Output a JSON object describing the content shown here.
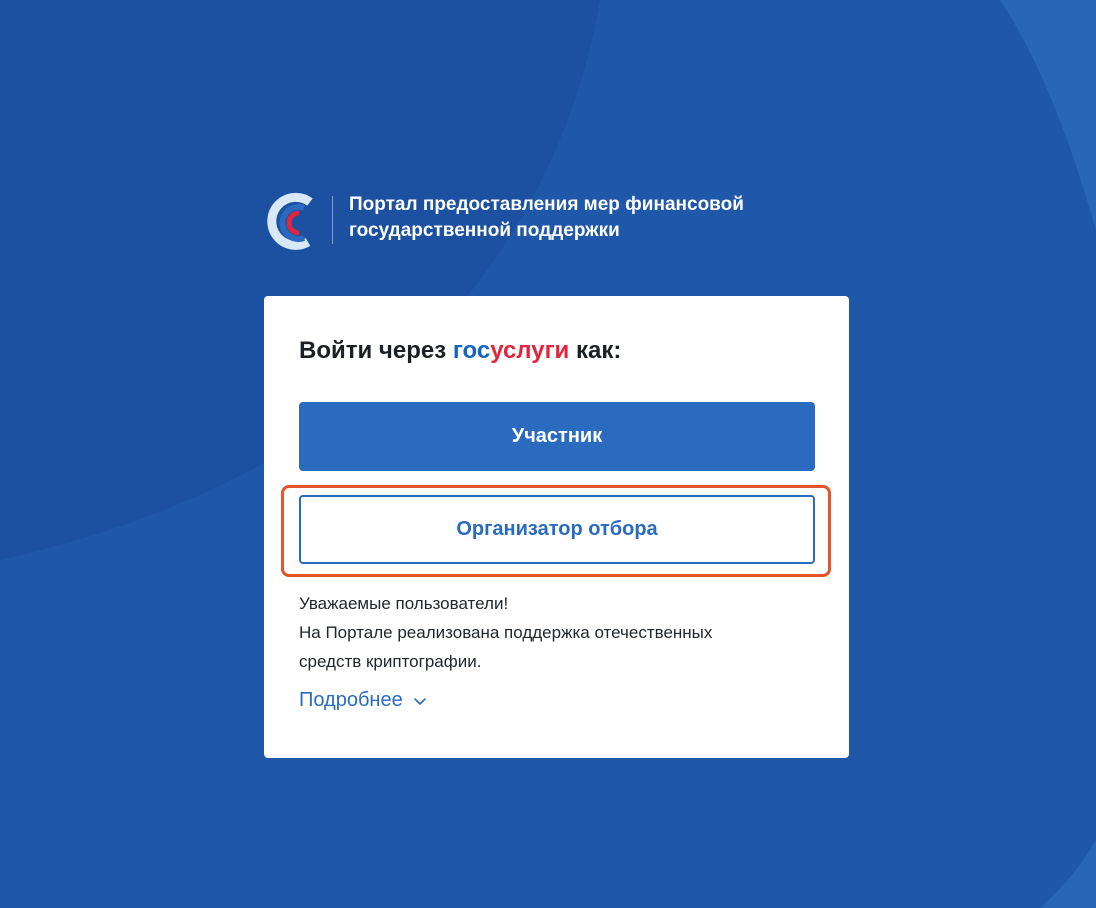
{
  "header": {
    "title_line1": "Портал предоставления мер финансовой",
    "title_line2": "государственной поддержки"
  },
  "login": {
    "title_prefix": "Войти через",
    "brand_gos": "гос",
    "brand_uslugi": "услуги",
    "title_suffix": "как:"
  },
  "buttons": {
    "participant": "Участник",
    "organizer": "Организатор отбора"
  },
  "notice": {
    "line1": "Уважаемые пользователи!",
    "line2": "На Портале реализована поддержка отечественных",
    "line3": "средств криптографии."
  },
  "more_link": {
    "label": "Подробнее",
    "icon": "chevron-down-icon"
  },
  "colors": {
    "background": "#1f58a8",
    "primary": "#2a6bc0",
    "highlight": "#e5532b",
    "brand_blue": "#1565c0",
    "brand_red": "#e0253c"
  }
}
